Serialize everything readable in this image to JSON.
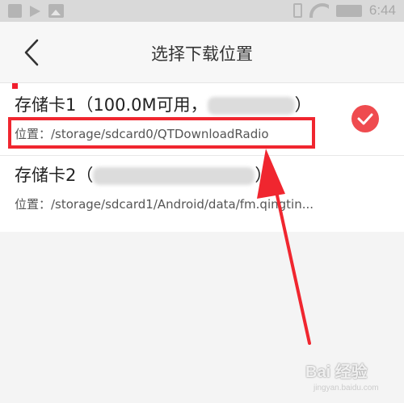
{
  "status_bar": {
    "time": "6:44"
  },
  "header": {
    "title": "选择下载位置"
  },
  "storage_list": [
    {
      "title_prefix": "存储卡1（100.0M可用，",
      "title_suffix": "）",
      "path": "位置：/storage/sdcard0/QTDownloadRadio",
      "selected": true
    },
    {
      "title_prefix": "存储卡2（",
      "title_suffix": "）",
      "path": "位置：/storage/sdcard1/Android/data/fm.qingtin..."
    }
  ],
  "watermark": {
    "text": "Bai 经验",
    "sub": "jingyan.baidu.com"
  },
  "colors": {
    "accent": "#ef4b4f",
    "annotation": "#f0262f"
  }
}
